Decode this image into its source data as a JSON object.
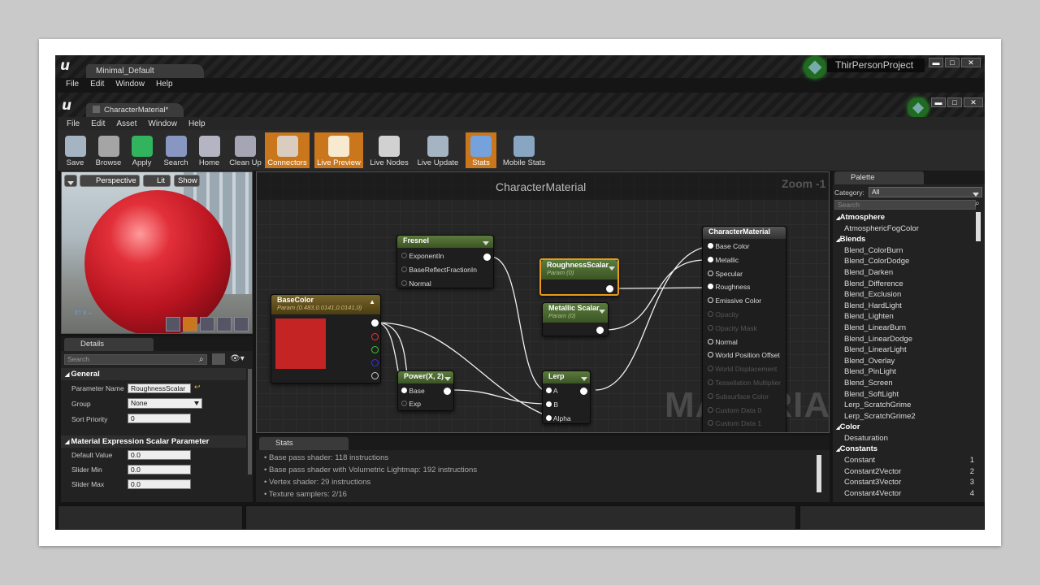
{
  "outer_window": {
    "tab": "Minimal_Default",
    "menu": [
      "File",
      "Edit",
      "Window",
      "Help"
    ],
    "project": "ThirPersonProject",
    "controls": [
      "▬",
      "□",
      "✕"
    ]
  },
  "editor": {
    "tab": "CharacterMaterial*",
    "menu": [
      "File",
      "Edit",
      "Asset",
      "Window",
      "Help"
    ],
    "controls": [
      "▬",
      "□",
      "✕"
    ]
  },
  "toolbar": [
    {
      "label": "Save",
      "icon": "save-icon",
      "active": false
    },
    {
      "label": "Browse",
      "icon": "browse-icon",
      "active": false
    },
    {
      "label": "Apply",
      "icon": "apply-icon",
      "active": false
    },
    {
      "label": "Search",
      "icon": "search-icon",
      "active": false
    },
    {
      "label": "Home",
      "icon": "home-icon",
      "active": false
    },
    {
      "label": "Clean Up",
      "icon": "cleanup-icon",
      "active": false
    },
    {
      "label": "Connectors",
      "icon": "connectors-icon",
      "active": true
    },
    {
      "label": "Live Preview",
      "icon": "live-preview-icon",
      "active": true
    },
    {
      "label": "Live Nodes",
      "icon": "live-nodes-icon",
      "active": false
    },
    {
      "label": "Live Update",
      "icon": "live-update-icon",
      "active": false
    },
    {
      "label": "Stats",
      "icon": "stats-icon",
      "active": true
    },
    {
      "label": "Mobile Stats",
      "icon": "mobile-stats-icon",
      "active": false
    }
  ],
  "viewport": {
    "perspective": "Perspective",
    "lit": "Lit",
    "show": "Show"
  },
  "details": {
    "tab": "Details",
    "search_placeholder": "Search",
    "general": "General",
    "param_name_label": "Parameter Name",
    "param_name_value": "RoughnessScalar",
    "group_label": "Group",
    "group_value": "None",
    "sort_label": "Sort Priority",
    "sort_value": "0",
    "section2": "Material Expression Scalar Parameter",
    "default_label": "Default Value",
    "default_value": "0.0",
    "slider_min_label": "Slider Min",
    "slider_min_value": "0.0",
    "slider_max_label": "Slider Max",
    "slider_max_value": "0.0"
  },
  "graph": {
    "title": "CharacterMaterial",
    "zoom": "Zoom -1",
    "watermark": "MATERIAL",
    "fresnel": {
      "title": "Fresnel",
      "pins": [
        "ExponentIn",
        "BaseReflectFractionIn",
        "Normal"
      ]
    },
    "basecolor": {
      "title": "BaseColor",
      "sub": "Param (0.483,0.0141,0.0141,0)",
      "swatch": "#c42424"
    },
    "roughness": {
      "title": "RoughnessScalar",
      "sub": "Param (0)"
    },
    "metallic": {
      "title": "Metallic Scalar",
      "sub": "Param (0)"
    },
    "power": {
      "title": "Power(X, 2)",
      "pins": [
        "Base",
        "Exp"
      ]
    },
    "lerp": {
      "title": "Lerp",
      "pins": [
        "A",
        "B",
        "Alpha"
      ]
    },
    "result": {
      "title": "CharacterMaterial",
      "pins": [
        "Base Color",
        "Metallic",
        "Specular",
        "Roughness",
        "Emissive Color",
        "Opacity",
        "Opacity Mask",
        "Normal",
        "World Position Offset",
        "World Displacement",
        "Tessellation Multiplier",
        "Subsurface Color",
        "Custom Data 0",
        "Custom Data 1"
      ]
    }
  },
  "stats": {
    "tab": "Stats",
    "lines": [
      "Base pass shader: 118 instructions",
      "Base pass shader with Volumetric Lightmap: 192 instructions",
      "Vertex shader: 29 instructions",
      "Texture samplers: 2/16"
    ]
  },
  "palette": {
    "tab": "Palette",
    "category_label": "Category:",
    "category_value": "All",
    "search_placeholder": "Search",
    "items": [
      {
        "t": "cat",
        "label": "Atmosphere"
      },
      {
        "t": "it",
        "label": "AtmosphericFogColor"
      },
      {
        "t": "cat",
        "label": "Blends"
      },
      {
        "t": "it",
        "label": "Blend_ColorBurn"
      },
      {
        "t": "it",
        "label": "Blend_ColorDodge"
      },
      {
        "t": "it",
        "label": "Blend_Darken"
      },
      {
        "t": "it",
        "label": "Blend_Difference"
      },
      {
        "t": "it",
        "label": "Blend_Exclusion"
      },
      {
        "t": "it",
        "label": "Blend_HardLight"
      },
      {
        "t": "it",
        "label": "Blend_Lighten"
      },
      {
        "t": "it",
        "label": "Blend_LinearBurn"
      },
      {
        "t": "it",
        "label": "Blend_LinearDodge"
      },
      {
        "t": "it",
        "label": "Blend_LinearLight"
      },
      {
        "t": "it",
        "label": "Blend_Overlay"
      },
      {
        "t": "it",
        "label": "Blend_PinLight"
      },
      {
        "t": "it",
        "label": "Blend_Screen"
      },
      {
        "t": "it",
        "label": "Blend_SoftLight"
      },
      {
        "t": "it",
        "label": "Lerp_ScratchGrime"
      },
      {
        "t": "it",
        "label": "Lerp_ScratchGrime2"
      },
      {
        "t": "cat",
        "label": "Color"
      },
      {
        "t": "it",
        "label": "Desaturation"
      },
      {
        "t": "cat",
        "label": "Constants"
      },
      {
        "t": "it",
        "label": "Constant",
        "key": "1"
      },
      {
        "t": "it",
        "label": "Constant2Vector",
        "key": "2"
      },
      {
        "t": "it",
        "label": "Constant3Vector",
        "key": "3"
      },
      {
        "t": "it",
        "label": "Constant4Vector",
        "key": "4"
      }
    ]
  },
  "colors": {
    "accent": "#c9761c",
    "node_header_green": "#4a6b30",
    "node_header_gold": "#6b5a1c",
    "selected": "#e89b1c"
  }
}
